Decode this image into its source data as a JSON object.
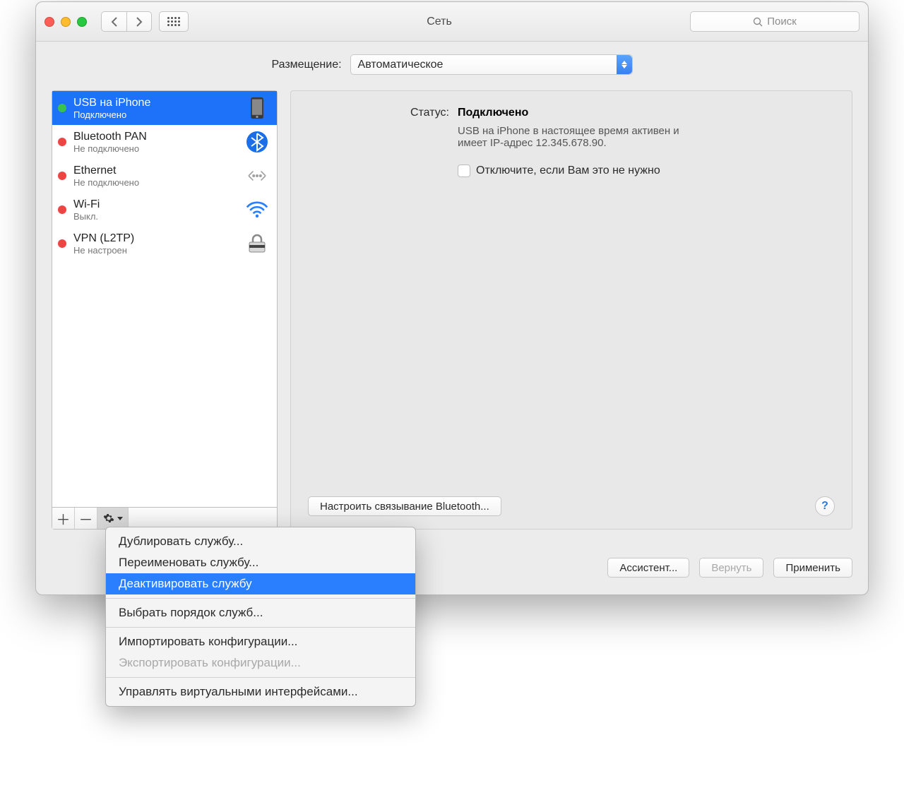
{
  "window": {
    "title": "Сеть"
  },
  "search": {
    "placeholder": "Поиск"
  },
  "location": {
    "label": "Размещение:",
    "value": "Автоматическое"
  },
  "services": [
    {
      "name": "USB на iPhone",
      "sub": "Подключено",
      "status": "green",
      "icon": "iphone",
      "selected": true
    },
    {
      "name": "Bluetooth PAN",
      "sub": "Не подключено",
      "status": "red",
      "icon": "bluetooth",
      "selected": false
    },
    {
      "name": "Ethernet",
      "sub": "Не подключено",
      "status": "red",
      "icon": "ethernet",
      "selected": false
    },
    {
      "name": "Wi-Fi",
      "sub": "Выкл.",
      "status": "red",
      "icon": "wifi",
      "selected": false
    },
    {
      "name": "VPN (L2TP)",
      "sub": "Не настроен",
      "status": "red",
      "icon": "vpn",
      "selected": false
    }
  ],
  "detail": {
    "status_label": "Статус:",
    "status_value": "Подключено",
    "description": "USB на iPhone в настоящее время активен и имеет IP-адрес 12.345.678.90.",
    "checkbox_label": "Отключите, если Вам это не нужно",
    "configure_btn": "Настроить связывание Bluetooth..."
  },
  "footer": {
    "assistant": "Ассистент...",
    "revert": "Вернуть",
    "apply": "Применить"
  },
  "menu": {
    "items": [
      {
        "label": "Дублировать службу...",
        "state": "normal"
      },
      {
        "label": "Переименовать службу...",
        "state": "normal"
      },
      {
        "label": "Деактивировать службу",
        "state": "highlight"
      },
      {
        "sep": true
      },
      {
        "label": "Выбрать порядок служб...",
        "state": "normal"
      },
      {
        "sep": true
      },
      {
        "label": "Импортировать конфигурации...",
        "state": "normal"
      },
      {
        "label": "Экспортировать конфигурации...",
        "state": "disabled"
      },
      {
        "sep": true
      },
      {
        "label": "Управлять виртуальными интерфейсами...",
        "state": "normal"
      }
    ]
  }
}
